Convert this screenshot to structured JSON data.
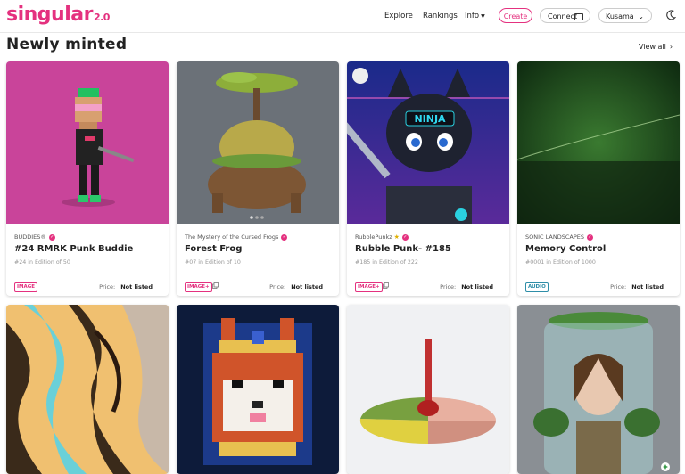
{
  "nav": {
    "logo": "singular",
    "logo_version": "2.0",
    "links": [
      "Explore",
      "Rankings",
      "Info"
    ],
    "create_label": "Create",
    "connect_label": "Connect",
    "network_label": "Kusama"
  },
  "section": {
    "title": "Newly minted",
    "view_all": "View all",
    "view_all_arrow": "›"
  },
  "cards": [
    {
      "collection": "BUDDIES®",
      "title": "#24 RMRK Punk Buddie",
      "edition": "#24 in Edition of 50",
      "badge": "IMAGE",
      "price_label": "Price:",
      "price_value": "Not listed",
      "verified": true
    },
    {
      "collection": "The Mystery of the Cursed Frogs",
      "title": "Forest Frog",
      "edition": "#07 in Edition of 10",
      "badge": "IMAGE+",
      "price_label": "Price:",
      "price_value": "Not listed",
      "verified": true
    },
    {
      "collection": "RubblePunkz",
      "title": "Rubble Punk- #185",
      "edition": "#185 in Edition of 222",
      "badge": "IMAGE+",
      "price_label": "Price:",
      "price_value": "Not listed",
      "verified": true
    },
    {
      "collection": "SONIC LANDSCAPES",
      "title": "Memory Control",
      "edition": "#0001 in Edition of 1000",
      "badge": "AUDIO",
      "price_label": "Price:",
      "price_value": "Not listed",
      "verified": true
    }
  ],
  "artwork": {
    "card1_ninja_text": "NINJA"
  },
  "colors": {
    "brand": "#e4317f",
    "audio": "#2f8ea8"
  }
}
